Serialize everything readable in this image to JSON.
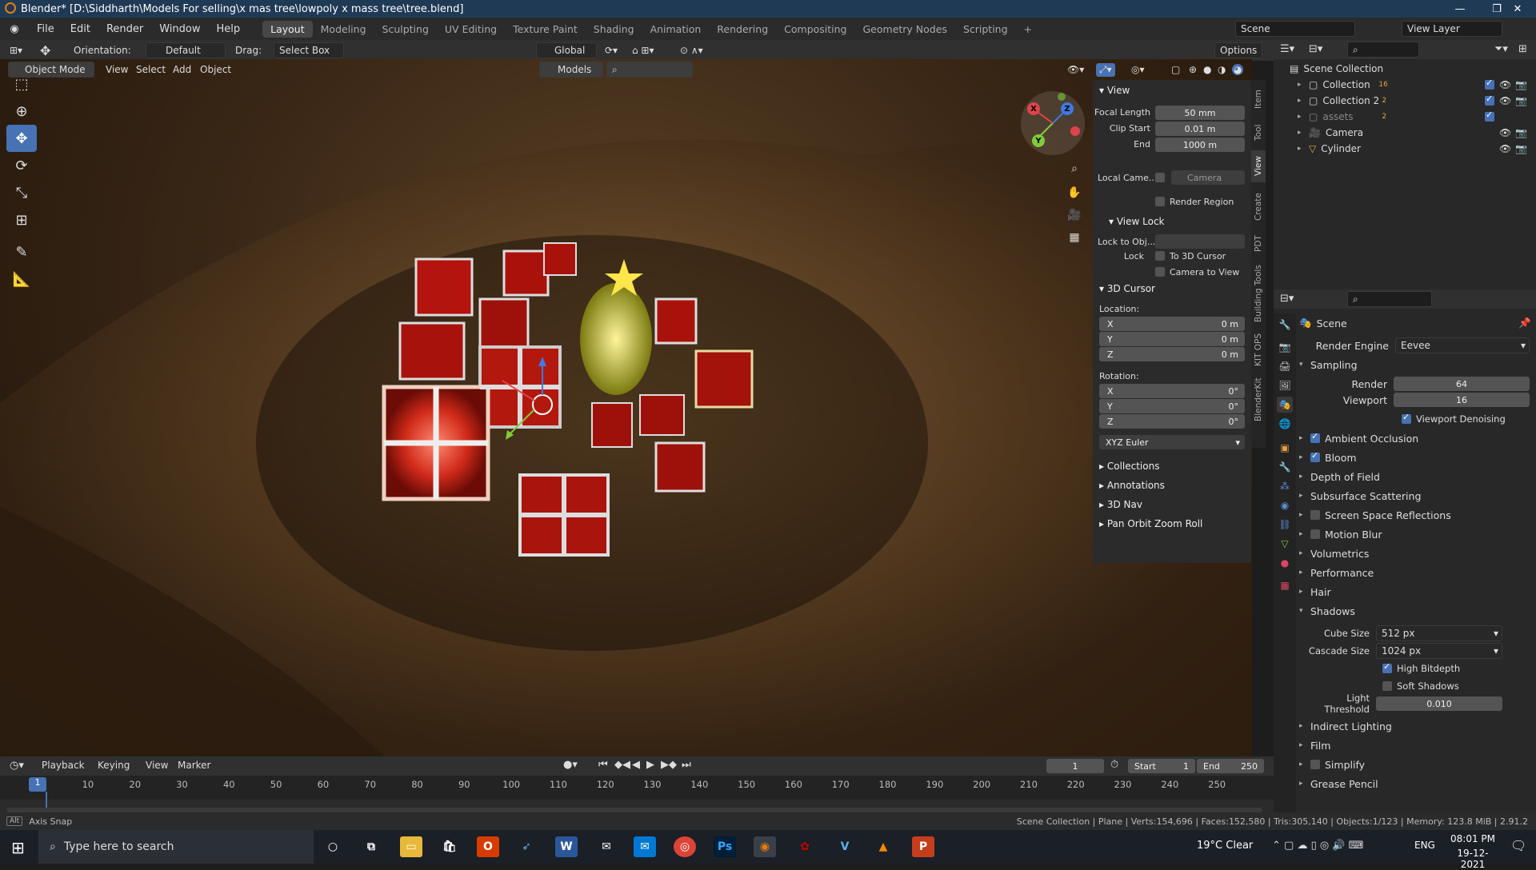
{
  "window": {
    "title": "Blender* [D:\\Siddharth\\Models For selling\\x mas tree\\lowpoly x mass tree\\tree.blend]",
    "min_icon": "—",
    "max_icon": "❐",
    "close_icon": "✕"
  },
  "menu": [
    "File",
    "Edit",
    "Render",
    "Window",
    "Help"
  ],
  "workspaces": [
    "Layout",
    "Modeling",
    "Sculpting",
    "UV Editing",
    "Texture Paint",
    "Shading",
    "Animation",
    "Rendering",
    "Compositing",
    "Geometry Nodes",
    "Scripting"
  ],
  "workspace_add": "+",
  "scene": {
    "scene_name": "Scene",
    "view_layer": "View Layer"
  },
  "tool_header": {
    "orientation_label": "Orientation:",
    "orientation_value": "Default",
    "drag_label": "Drag:",
    "drag_value": "Select Box",
    "transform_orientation": "Global",
    "options": "Options"
  },
  "viewport_header": {
    "mode": "Object Mode",
    "menus": [
      "View",
      "Select",
      "Add",
      "Object"
    ],
    "collection": "Models"
  },
  "gizmo": {
    "x": "X",
    "y": "Y",
    "z": "Z"
  },
  "npanel": {
    "view_section": "View",
    "focal_length_label": "Focal Length",
    "focal_length": "50 mm",
    "clip_start_label": "Clip Start",
    "clip_start": "0.01 m",
    "end_label": "End",
    "clip_end": "1000 m",
    "local_camera_label": "Local Came...",
    "local_camera_value": "Camera",
    "render_region": "Render Region",
    "view_lock_section": "View Lock",
    "lock_to_obj_label": "Lock to Obj...",
    "lock_label": "Lock",
    "to_3d_cursor": "To 3D Cursor",
    "camera_to_view": "Camera to View",
    "cursor_section": "3D Cursor",
    "location_label": "Location:",
    "loc_x_label": "X",
    "loc_x": "0 m",
    "loc_y_label": "Y",
    "loc_y": "0 m",
    "loc_z_label": "Z",
    "loc_z": "0 m",
    "rotation_label": "Rotation:",
    "rot_x_label": "X",
    "rot_x": "0°",
    "rot_y_label": "Y",
    "rot_y": "0°",
    "rot_z_label": "Z",
    "rot_z": "0°",
    "rotation_mode": "XYZ Euler",
    "collapsed": [
      "Collections",
      "Annotations",
      "3D Nav",
      "Pan Orbit Zoom Roll"
    ]
  },
  "side_tabs": [
    "Item",
    "Tool",
    "View",
    "Create",
    "PDT",
    "Building Tools",
    "KIT OPS",
    "BlenderKit"
  ],
  "outliner": {
    "root": "Scene Collection",
    "items": [
      "Collection",
      "Collection 2",
      "assets",
      "Camera",
      "Cylinder"
    ],
    "badges": [
      "16",
      "2",
      "2"
    ]
  },
  "properties": {
    "context": "Scene",
    "render_engine_label": "Render Engine",
    "render_engine": "Eevee",
    "sampling": "Sampling",
    "render_label": "Render",
    "render_samples": "64",
    "viewport_label": "Viewport",
    "viewport_samples": "16",
    "viewport_denoising": "Viewport Denoising",
    "panels": [
      "Ambient Occlusion",
      "Bloom",
      "Depth of Field",
      "Subsurface Scattering",
      "Screen Space Reflections",
      "Motion Blur",
      "Volumetrics",
      "Performance",
      "Hair"
    ],
    "shadows": "Shadows",
    "cube_size_label": "Cube Size",
    "cube_size": "512 px",
    "cascade_size_label": "Cascade Size",
    "cascade_size": "1024 px",
    "high_bitdepth": "High Bitdepth",
    "soft_shadows": "Soft Shadows",
    "light_threshold_label": "Light Threshold",
    "light_threshold": "0.010",
    "panels_after": [
      "Indirect Lighting",
      "Film",
      "Simplify",
      "Grease Pencil"
    ]
  },
  "timeline": {
    "menus": [
      "Playback",
      "Keying",
      "View",
      "Marker"
    ],
    "current_frame": "1",
    "start_label": "Start",
    "start": "1",
    "end_label": "End",
    "end": "250",
    "ticks": [
      "1",
      "10",
      "20",
      "30",
      "40",
      "50",
      "60",
      "70",
      "80",
      "90",
      "100",
      "110",
      "120",
      "130",
      "140",
      "150",
      "160",
      "170",
      "180",
      "190",
      "200",
      "210",
      "220",
      "230",
      "240",
      "250"
    ]
  },
  "status": {
    "hint_key": "Alt",
    "hint": "Axis Snap",
    "stats": "Scene Collection | Plane | Verts:154,696 | Faces:152,580 | Tris:305,140 | Objects:1/123 | Memory: 123.8 MiB | 2.91.2"
  },
  "taskbar": {
    "search_placeholder": "Type here to search",
    "weather": "19°C  Clear",
    "lang": "ENG",
    "time": "08:01 PM",
    "date": "19-12-2021"
  }
}
